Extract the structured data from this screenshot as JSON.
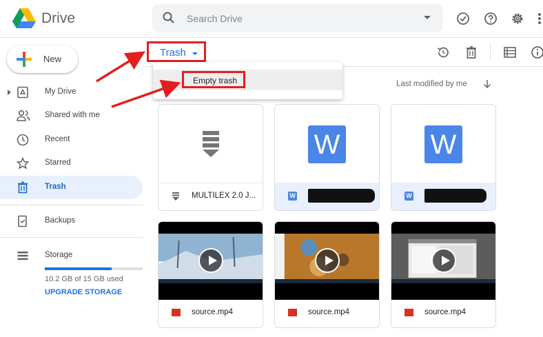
{
  "app": {
    "name": "Drive"
  },
  "search": {
    "placeholder": "Search Drive"
  },
  "sidebar": {
    "new_label": "New",
    "items": [
      {
        "label": "My Drive"
      },
      {
        "label": "Shared with me"
      },
      {
        "label": "Recent"
      },
      {
        "label": "Starred"
      },
      {
        "label": "Trash"
      },
      {
        "label": "Backups"
      }
    ],
    "storage": {
      "label": "Storage",
      "used_text": "10.2 GB of 15 GB used",
      "used_fraction": 0.68,
      "upgrade_label": "UPGRADE STORAGE"
    }
  },
  "main": {
    "title": "Trash",
    "menu": {
      "items": [
        {
          "label": "Empty trash"
        }
      ]
    },
    "sort_label": "Last modified by me",
    "files": [
      {
        "name": "MULTILEX 2.0 J...",
        "type": "archive"
      },
      {
        "name": "",
        "type": "word",
        "redacted": true
      },
      {
        "name": "",
        "type": "word",
        "redacted": true
      },
      {
        "name": "source.mp4",
        "type": "video"
      },
      {
        "name": "source.mp4",
        "type": "video"
      },
      {
        "name": "source.mp4",
        "type": "video"
      }
    ]
  },
  "colors": {
    "accent": "#1a73e8",
    "highlight": "#e41e1e",
    "active_bg": "#e8f0fe"
  }
}
